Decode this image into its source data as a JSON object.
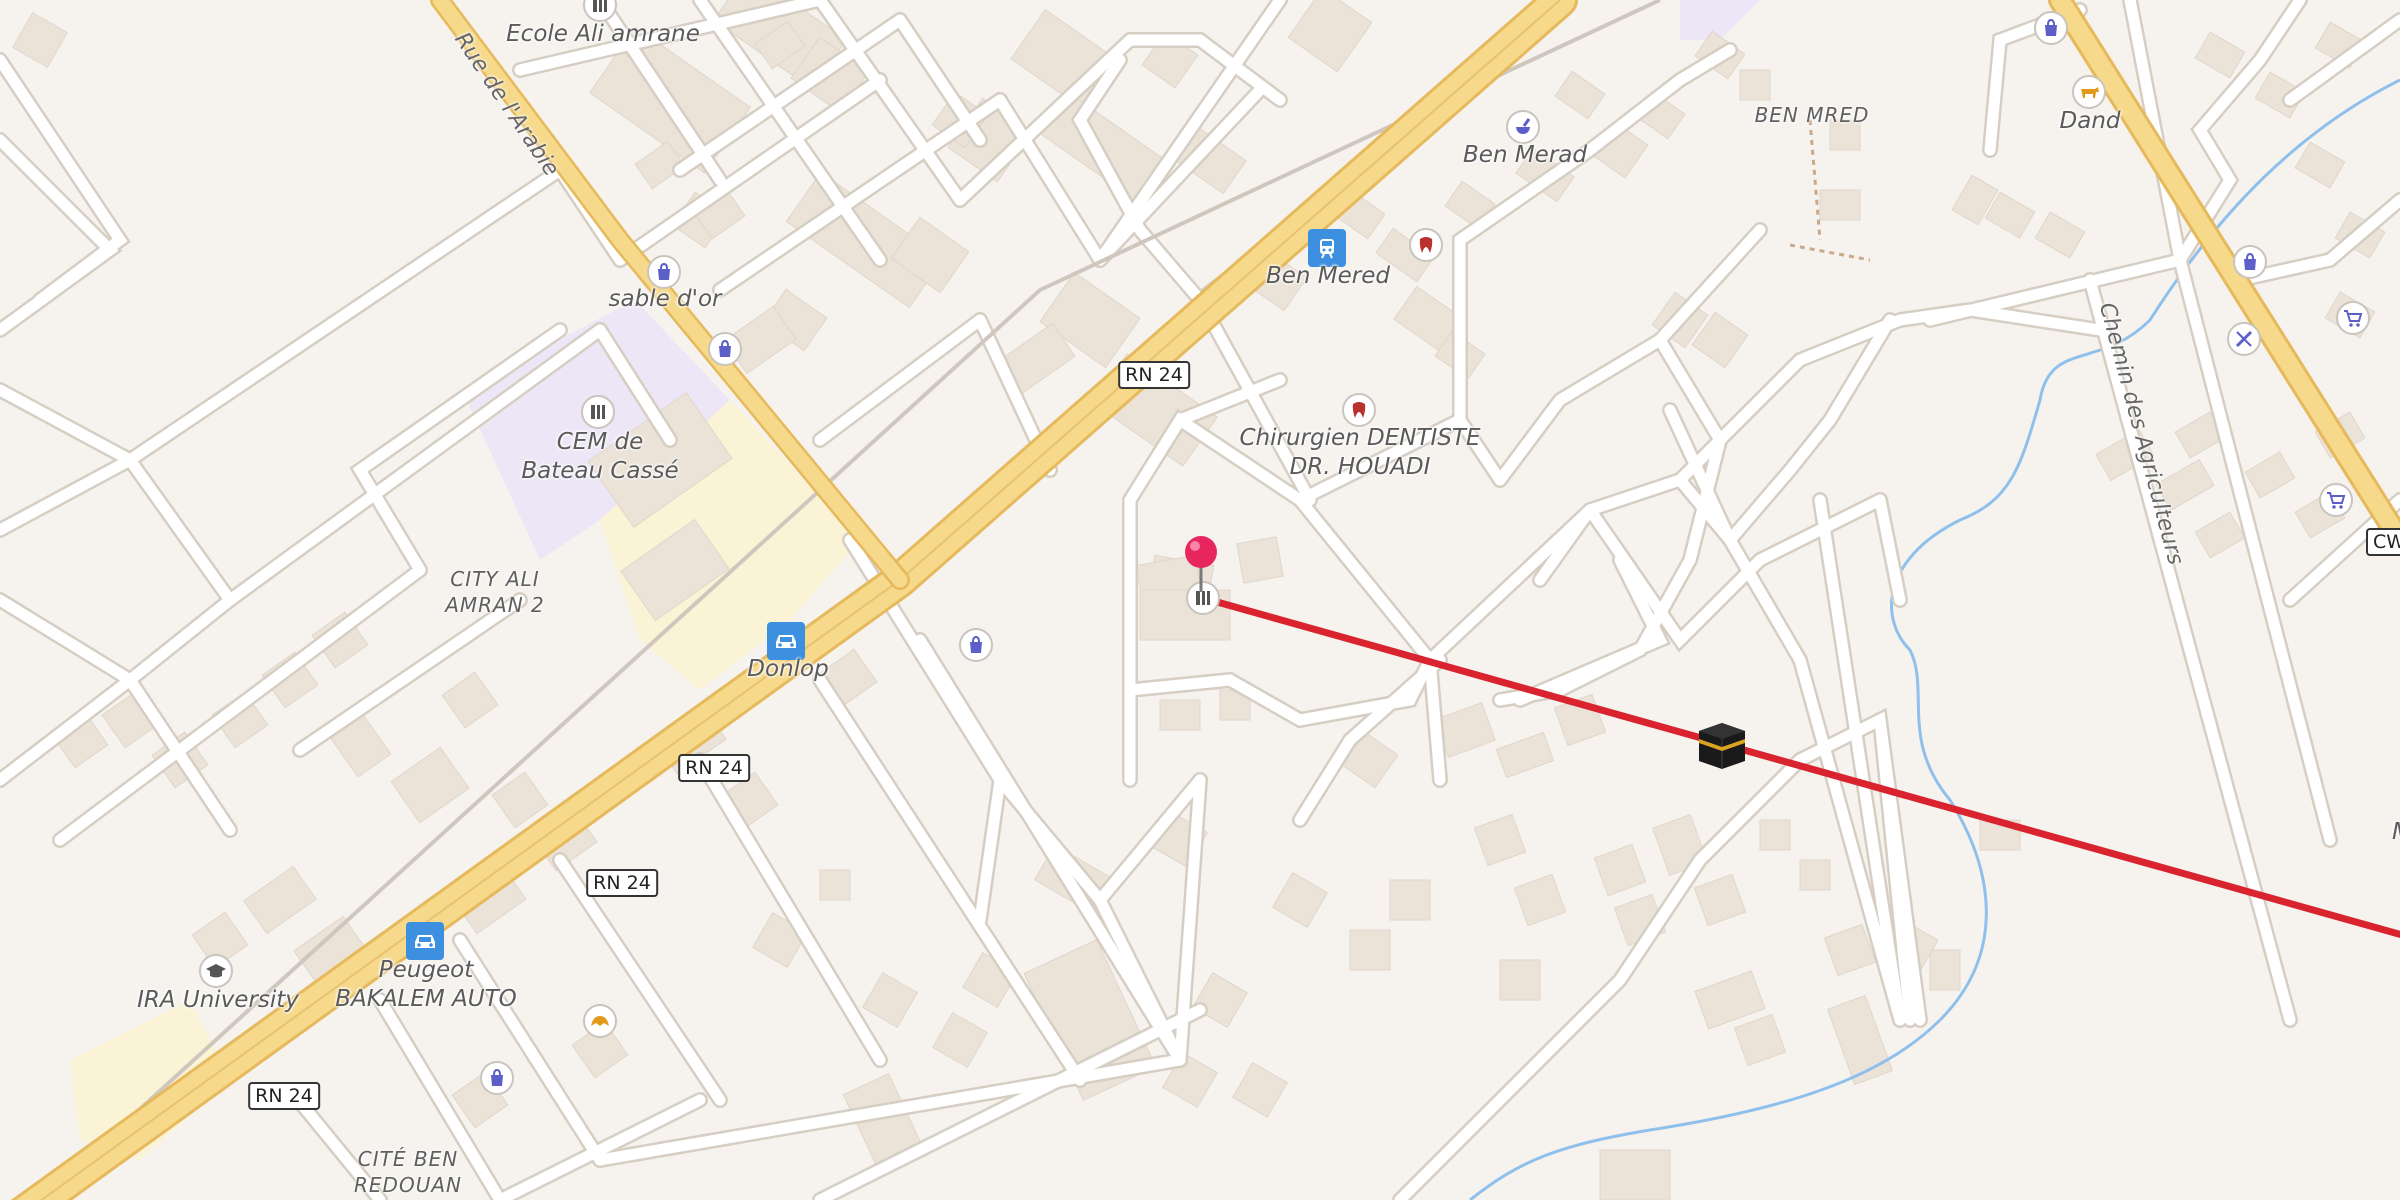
{
  "map": {
    "places": {
      "ecole_ali_amrane": "Ecole Ali amrane",
      "sable_dor": "sable d'or",
      "cem": "CEM de\nBateau Cassé",
      "city_ali_amran": "CITY ALI\nAMRAN 2",
      "donlop": "Donlop",
      "ira_university": "IRA University",
      "peugeot": "Peugeot\nBAKALEM AUTO",
      "cite_ben_redouan": "CITÉ BEN\nREDOUAN",
      "ben_merad": "Ben Merad",
      "ben_mered_station": "Ben Mered",
      "ben_mred_area": "BEN MRED",
      "chirurgien": "Chirurgien DENTISTE\nDR. HOUADI",
      "dand": "Dand",
      "edge_m": "M"
    },
    "roads": {
      "rue_arabie": "Rue de l'Arabie",
      "chemin_agriculteurs": "Chemin des Agriculteurs"
    },
    "shields": [
      "RN 24",
      "RN 24",
      "RN 24",
      "RN 24",
      "RN 24",
      "CW 115"
    ],
    "icons": {
      "pharmacy": "mortar-pestle-icon",
      "dentist": "tooth-icon",
      "school": "school-icon",
      "shop": "shopping-bag-icon",
      "supermarket": "shopping-cart-icon",
      "station": "train-icon",
      "car": "car-icon",
      "university": "graduation-cap-icon",
      "bakery": "croissant-icon",
      "butcher": "cow-icon",
      "qibla": "kaaba-icon",
      "pin": "location-pin-icon"
    },
    "colors": {
      "background": "#f6f3ef",
      "primary_road": "#f6d98a",
      "primary_road_casing": "#e6b95c",
      "minor_road": "#ffffff",
      "building": "#ebe2d8",
      "school_area": "#ece6f6",
      "yellow_area": "#fbf3d5",
      "water": "#8fc0ec",
      "qibla_line": "#d9232e",
      "pin": "#e8265e",
      "poi_icon": "#5b5fc7",
      "dentist_icon": "#b8322f",
      "shield_border": "#333333"
    }
  }
}
